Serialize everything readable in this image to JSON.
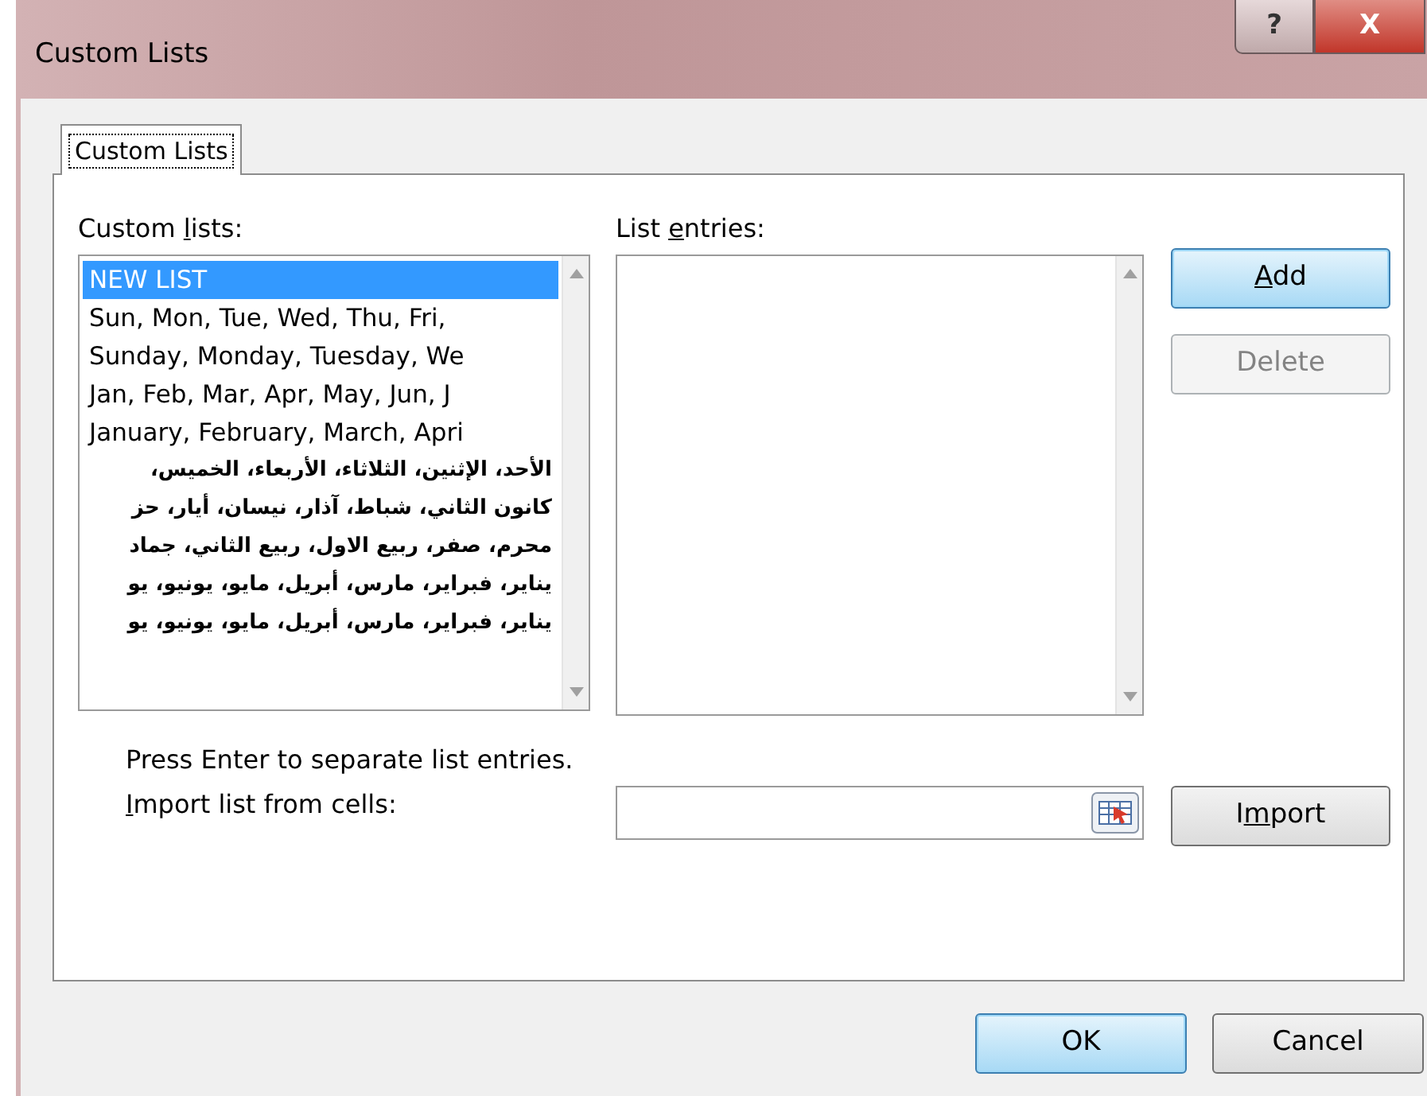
{
  "window": {
    "title": "Custom Lists",
    "buttons": [
      {
        "kind": "help",
        "label": "?"
      },
      {
        "kind": "close",
        "label": "X"
      }
    ]
  },
  "tabs": [
    {
      "label": "Custom Lists",
      "selected": true
    }
  ],
  "custom_lists": {
    "label": {
      "before": "Custom ",
      "key": "l",
      "after": "ists:"
    },
    "items": [
      {
        "text": "NEW LIST",
        "selected": true
      },
      {
        "text": "Sun, Mon, Tue, Wed, Thu, Fri,",
        "selected": false
      },
      {
        "text": "Sunday, Monday, Tuesday, We",
        "selected": false
      },
      {
        "text": "Jan, Feb, Mar, Apr, May, Jun, J",
        "selected": false
      },
      {
        "text": "January, February, March, Apri",
        "selected": false
      },
      {
        "text": "الأحد، الإثنين، الثلاثاء، الأربعاء، الخميس،",
        "selected": false
      },
      {
        "text": "كانون الثاني، شباط، آذار، نيسان، أيار، حز",
        "selected": false
      },
      {
        "text": "محرم، صفر، ربيع الاول، ربيع الثاني، جماد",
        "selected": false
      },
      {
        "text": "يناير، فبراير، مارس، أبريل، مايو، يونيو، يو",
        "selected": false
      },
      {
        "text": "يناير، فبراير، مارس، أبريل، مايو، يونيو، يو",
        "selected": false
      }
    ]
  },
  "list_entries": {
    "label": {
      "before": "List ",
      "key": "e",
      "after": "ntries:"
    }
  },
  "side_buttons": [
    {
      "label": {
        "key": "A",
        "after": "dd"
      },
      "disabled": false,
      "default": true
    },
    {
      "label": {
        "before": "Delete"
      },
      "disabled": true,
      "default": false
    }
  ],
  "hint": "Press Enter to separate list entries.",
  "import": {
    "label": {
      "key": "I",
      "after": "mport list from cells:"
    },
    "button": {
      "before": "I",
      "key": "m",
      "after": "port"
    }
  },
  "footer_buttons": [
    {
      "label": "OK",
      "default": true
    },
    {
      "label": "Cancel",
      "default": false
    }
  ]
}
